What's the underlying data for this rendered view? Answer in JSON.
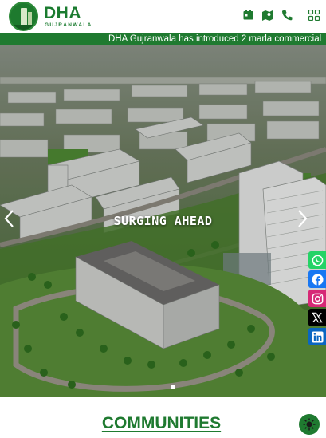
{
  "header": {
    "logo_text": "DHA",
    "logo_subtext": "GUJRANWALA",
    "icons": [
      "calendar-icon",
      "map-icon",
      "phone-icon",
      "grid-menu-icon"
    ]
  },
  "ticker": {
    "text": "DHA Gujranwala has introduced 2 marla commercial"
  },
  "hero": {
    "caption": "SURGING AHEAD",
    "slide_index": 1
  },
  "social": [
    "whatsapp-icon",
    "facebook-icon",
    "instagram-icon",
    "x-icon",
    "linkedin-icon"
  ],
  "section": {
    "title": "COMMUNITIES"
  },
  "colors": {
    "brand_green": "#1f7a30",
    "whatsapp": "#25d366",
    "facebook": "#1877f2",
    "instagram": "#d62976",
    "x": "#000000",
    "linkedin": "#0a66c2"
  }
}
